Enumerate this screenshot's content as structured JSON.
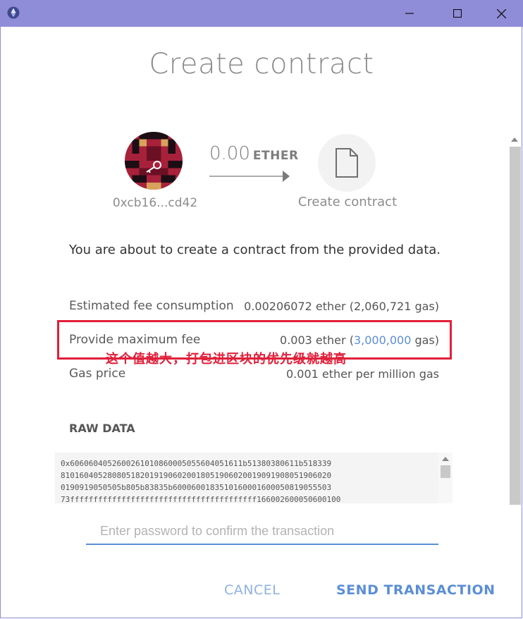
{
  "window": {
    "app_icon": "ethereum-icon",
    "controls": [
      "minimize-icon",
      "maximize-icon",
      "close-icon"
    ],
    "titlebar_color": "#8f8cd8"
  },
  "title": "Create contract",
  "from": {
    "address": "0xcb16...cd42",
    "avatar": "identicon-avatar"
  },
  "amount": {
    "value": "0.00",
    "unit": "ETHER"
  },
  "to": {
    "icon": "document-icon",
    "label": "Create contract"
  },
  "description": "You are about to create a contract from the provided data.",
  "fees": {
    "estimated_label": "Estimated fee consumption",
    "estimated_value": "0.00206072 ether (2,060,721 gas)",
    "max_label": "Provide maximum fee",
    "max_value_prefix": "0.003 ether (",
    "max_gas_link": "3,000,000",
    "max_value_suffix": " gas)",
    "gas_price_label": "Gas price",
    "gas_price_value": "0.001 ether per million gas"
  },
  "annotation": {
    "text": "这个值越大，打包进区块的优先级就越高",
    "color": "#e0203a"
  },
  "raw_data": {
    "label": "RAW DATA",
    "line1": "0x6060604052600261010860005055604051611b51380380611b518339",
    "line2": "8101604052808051820191906020018051906020019091908051906020",
    "line3": "0190919050505b805b83835b6000600183510160001600050819055503",
    "line4": "73ffffffffffffffffffffffffffffffffffffffff166002600050600100"
  },
  "password": {
    "placeholder": "Enter password to confirm the transaction",
    "value": ""
  },
  "actions": {
    "cancel": "CANCEL",
    "send": "SEND TRANSACTION"
  },
  "colors": {
    "accent": "#5b8ed6",
    "annotation": "#e0203a"
  }
}
